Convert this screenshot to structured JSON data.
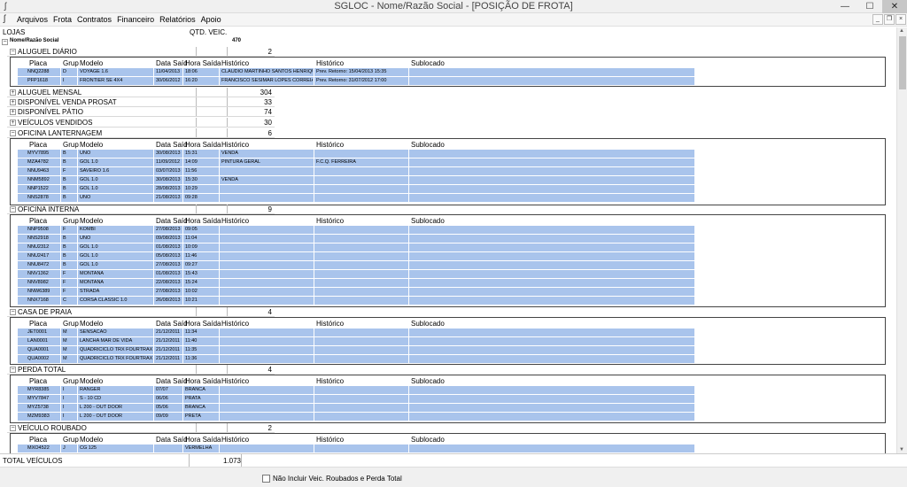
{
  "window": {
    "title": "SGLOC - Nome/Razão Social - [POSIÇÃO DE FROTA]"
  },
  "menu": [
    "Arquivos",
    "Frota",
    "Contratos",
    "Financeiro",
    "Relatórios",
    "Apoio"
  ],
  "header": {
    "lojas": "LOJAS",
    "qtd": "QTD. VEIC."
  },
  "root": {
    "label": "Nome/Razão Social",
    "count": "470"
  },
  "columns": {
    "placa": "Placa",
    "grup": "Grup",
    "modelo": "Modelo",
    "data_saida": "Data Saíd",
    "hora_saida": "Hora Saída",
    "historico1": "Histórico",
    "historico2": "Histórico",
    "sublocado": "Sublocado"
  },
  "groups": {
    "aluguel_diario": {
      "label": "ALUGUEL DIÁRIO",
      "count": "2",
      "rows": [
        [
          "NNQ2288",
          "D",
          "VOYAGE 1.6",
          "11/04/2013",
          "18:06",
          "CLAUDIO MARTINHO SANTOS HENRIQU",
          "Prev. Retorno: 15/04/2013 15:35",
          ""
        ],
        [
          "PFP1618",
          "I",
          "FRONTIER SE 4X4",
          "30/06/2012",
          "16:20",
          "FRANCISCO SESIMAR LOPES CORREIA",
          "Prev. Retorno: 31/07/2012 17:00",
          ""
        ]
      ]
    },
    "aluguel_mensal": {
      "label": "ALUGUEL MENSAL",
      "count": "304"
    },
    "disp_venda": {
      "label": "DISPONÍVEL VENDA PROSAT",
      "count": "33"
    },
    "disp_patio": {
      "label": "DISPONÍVEL PÁTIO",
      "count": "74"
    },
    "vendidos": {
      "label": "VEÍCULOS VENDIDOS",
      "count": "30"
    },
    "lanternagem": {
      "label": "OFICINA LANTERNAGEM",
      "count": "6",
      "rows": [
        [
          "MYV7895",
          "B",
          "UNO",
          "30/08/2013",
          "15:31",
          "VENDA",
          "",
          ""
        ],
        [
          "MZA4782",
          "B",
          "GOL 1.0",
          "11/09/2012",
          "14:09",
          "PINTURA GERAL",
          "F.C.Q. FERREIRA",
          ""
        ],
        [
          "NNU9463",
          "F",
          "SAVEIRO 1.6",
          "03/07/2013",
          "11:56",
          "",
          "",
          ""
        ],
        [
          "NNM5892",
          "B",
          "GOL 1.0",
          "30/08/2013",
          "15:30",
          "VENDA",
          "",
          ""
        ],
        [
          "NNP1522",
          "B",
          "GOL 1.0",
          "28/08/2013",
          "10:29",
          "",
          "",
          ""
        ],
        [
          "NNS2878",
          "B",
          "UNO",
          "21/08/2013",
          "09:28",
          "",
          "",
          ""
        ]
      ]
    },
    "interna": {
      "label": "OFICINA INTERNA",
      "count": "9",
      "rows": [
        [
          "NNP9508",
          "F",
          "KOMBI",
          "27/08/2013",
          "09:05",
          "",
          "",
          ""
        ],
        [
          "NNS2918",
          "B",
          "UNO",
          "09/08/2013",
          "11:04",
          "",
          "",
          ""
        ],
        [
          "NNU2312",
          "B",
          "GOL 1.0",
          "01/08/2013",
          "10:09",
          "",
          "",
          ""
        ],
        [
          "NNU2417",
          "B",
          "GOL 1.0",
          "05/08/2013",
          "11:46",
          "",
          "",
          ""
        ],
        [
          "NNU8472",
          "B",
          "GOL 1.0",
          "27/08/2013",
          "09:27",
          "",
          "",
          ""
        ],
        [
          "NNV1362",
          "F",
          "MONTANA",
          "01/08/2013",
          "15:43",
          "",
          "",
          ""
        ],
        [
          "NNV8982",
          "F",
          "MONTANA",
          "22/08/2013",
          "15:24",
          "",
          "",
          ""
        ],
        [
          "NNW6389",
          "F",
          "STRADA",
          "27/08/2013",
          "10:02",
          "",
          "",
          ""
        ],
        [
          "NNX7168",
          "C",
          "CORSA CLASSIC 1.0",
          "26/08/2013",
          "10:21",
          "",
          "",
          ""
        ]
      ]
    },
    "praia": {
      "label": "CASA DE PRAIA",
      "count": "4",
      "rows": [
        [
          "JET0001",
          "M",
          "SENSACAO",
          "21/12/2011",
          "11:34",
          "",
          "",
          ""
        ],
        [
          "LAN0001",
          "M",
          "LANCHA MAR DE VIDA",
          "21/12/2011",
          "11:40",
          "",
          "",
          ""
        ],
        [
          "QUA0001",
          "M",
          "QUADRICICLO TRX FOURTRAX",
          "21/12/2011",
          "11:35",
          "",
          "",
          ""
        ],
        [
          "QUA0002",
          "M",
          "QUADRICICLO TRX FOURTRAX",
          "21/12/2011",
          "11:36",
          "",
          "",
          ""
        ]
      ]
    },
    "perda": {
      "label": "PERDA TOTAL",
      "count": "4",
      "rows": [
        [
          "MYR8385",
          "I",
          "RANGER",
          "07/07",
          "BRANCA",
          "",
          "",
          ""
        ],
        [
          "MYV7847",
          "I",
          "S - 10 CD",
          "06/06",
          "PRATA",
          "",
          "",
          ""
        ],
        [
          "MYZ5738",
          "I",
          "L 200 - OUT DOOR",
          "05/06",
          "BRANCA",
          "",
          "",
          ""
        ],
        [
          "MZM9383",
          "I",
          "L 200 - OUT DOOR",
          "09/09",
          "PRETA",
          "",
          "",
          ""
        ]
      ]
    },
    "roubado": {
      "label": "VEÍCULO ROUBADO",
      "count": "2",
      "rows": [
        [
          "MXO4522",
          "J",
          "CG 125",
          "",
          "VERMELHA",
          "",
          "",
          ""
        ]
      ]
    }
  },
  "footer": {
    "total_label": "TOTAL VEÍCULOS",
    "total": "1.073",
    "checkbox_label": "Não Incluir Veic. Roubados e Perda Total"
  },
  "colors": {
    "row_bg": "#a9c4ec"
  }
}
